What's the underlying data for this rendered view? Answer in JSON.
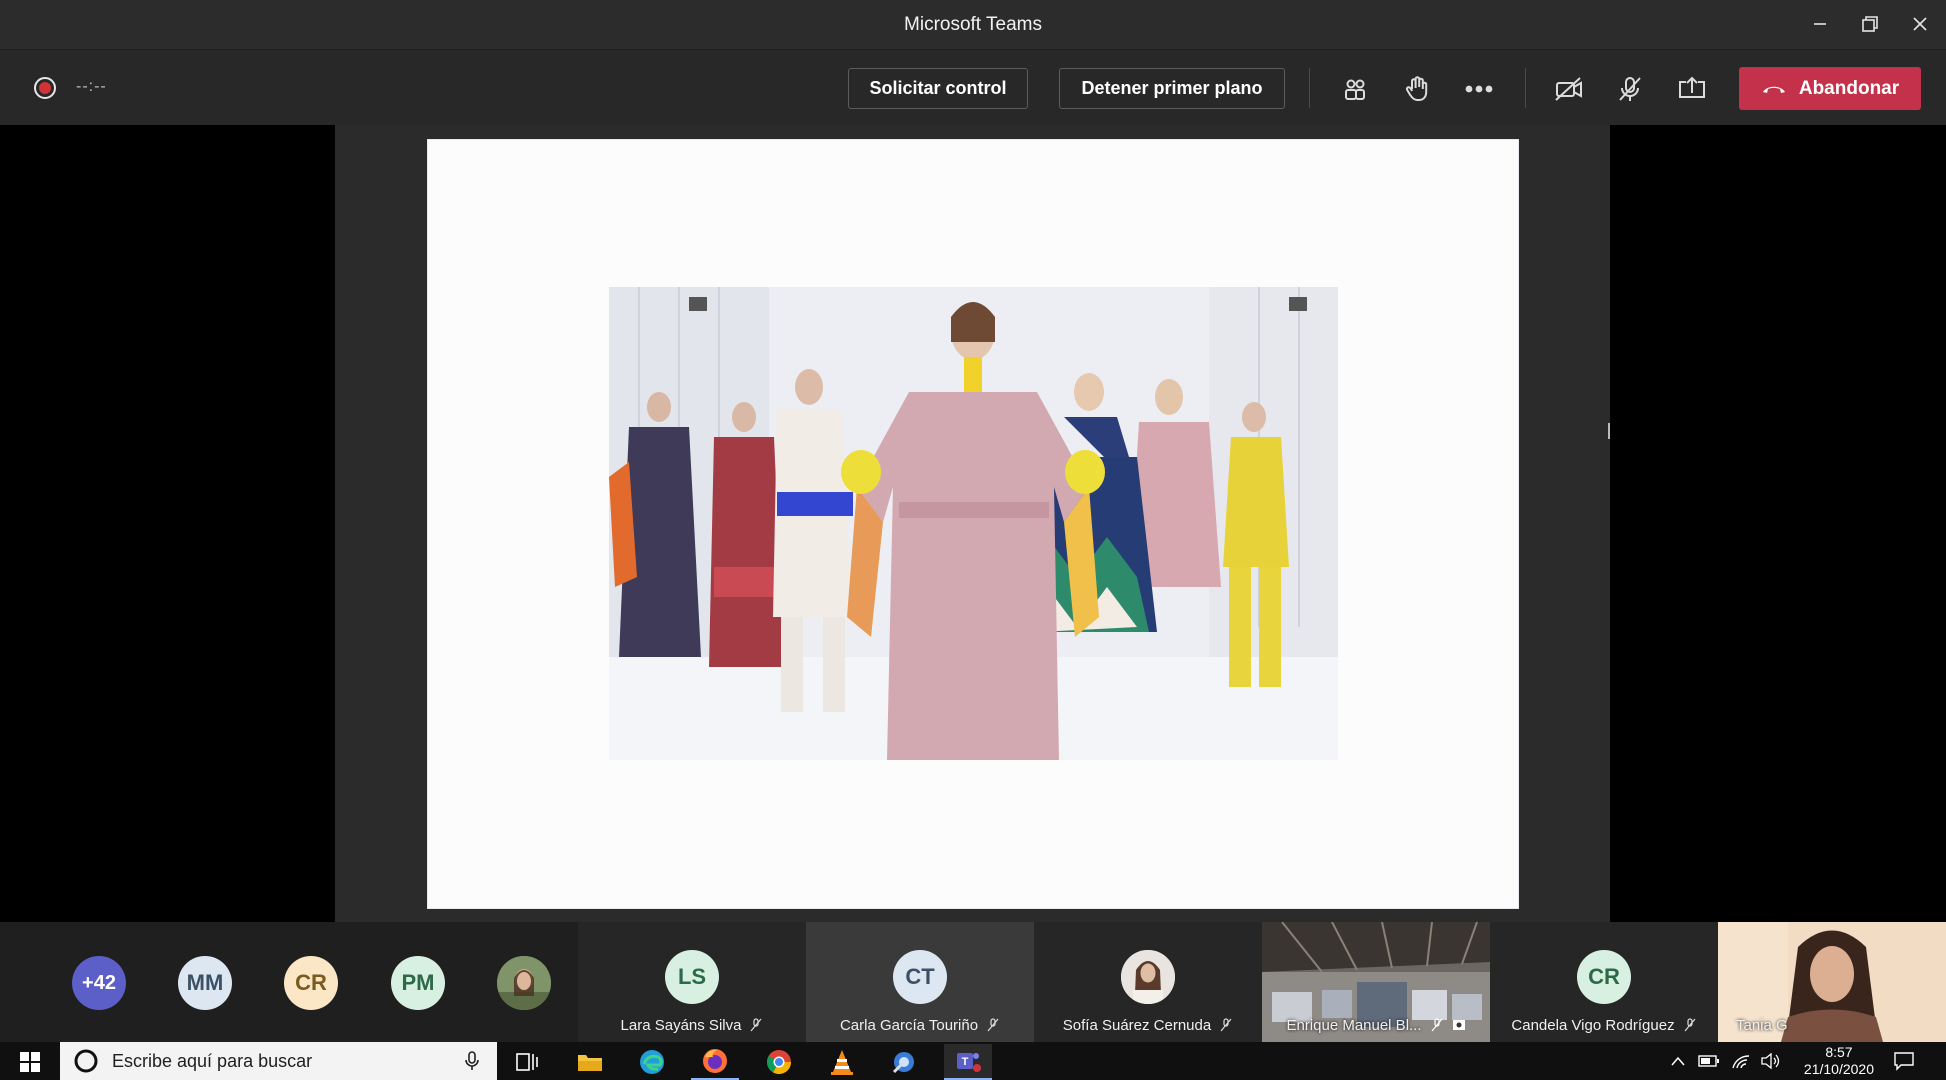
{
  "window": {
    "title": "Microsoft Teams"
  },
  "toolbar": {
    "timer": "--:--",
    "request_control_label": "Solicitar control",
    "stop_spotlight_label": "Detener primer plano",
    "leave_label": "Abandonar"
  },
  "participants": {
    "overflow_count": "+42",
    "avatars": [
      {
        "initials": "MM",
        "bg": "#dde7f1",
        "fg": "#3d5166"
      },
      {
        "initials": "CR",
        "bg": "#fbe7c6",
        "fg": "#7a5a1e"
      },
      {
        "initials": "PM",
        "bg": "#d8f0e2",
        "fg": "#2d6a47"
      }
    ],
    "tiles": [
      {
        "initials": "LS",
        "name": "Lara Sayáns Silva",
        "bg": "#d8f0e2",
        "fg": "#2d6a47"
      },
      {
        "initials": "CT",
        "name": "Carla García Touriño",
        "bg": "#dde7f1",
        "fg": "#3d5166"
      },
      {
        "initials": "",
        "name": "Sofía Suárez Cernuda"
      },
      {
        "initials": "",
        "name": "Enrique Manuel Bl..."
      },
      {
        "initials": "CR",
        "name": "Candela Vigo Rodríguez",
        "bg": "#d8f0e2",
        "fg": "#2d6a47"
      },
      {
        "initials": "",
        "name": "Tania G"
      }
    ]
  },
  "taskbar": {
    "search_placeholder": "Escribe aquí para buscar",
    "time": "8:57",
    "date": "21/10/2020"
  },
  "colors": {
    "leave": "#c4314b",
    "overflow_avatar": "#5b5fc7",
    "record": "#d13438"
  }
}
